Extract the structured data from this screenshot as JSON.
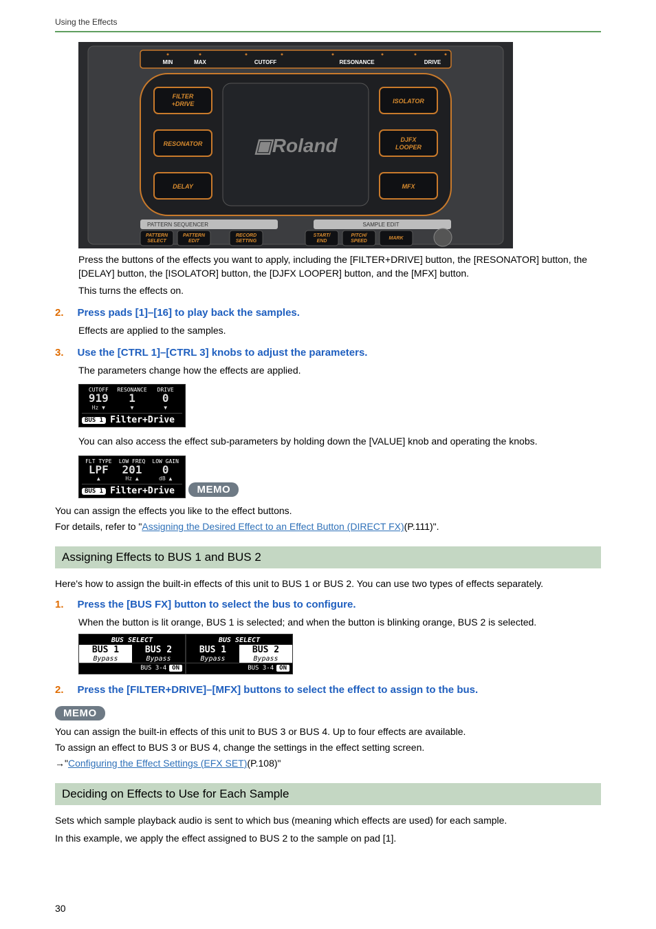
{
  "running_head": "Using the Effects",
  "page_number": "30",
  "hero": {
    "top_labels": [
      "MIN",
      "MAX",
      "CUTOFF",
      "RESONANCE",
      "DRIVE"
    ],
    "left_buttons": [
      "FILTER\n+DRIVE",
      "RESONATOR",
      "DELAY"
    ],
    "center_logo": "Roland",
    "right_buttons": [
      "ISOLATOR",
      "DJFX\nLOOPER",
      "MFX"
    ],
    "strip_left": "PATTERN SEQUENCER",
    "strip_right": "SAMPLE EDIT",
    "bottom_buttons": [
      "PATTERN\nSELECT",
      "PATTERN\nEDIT",
      "RECORD\nSETTING",
      "START/\nEND",
      "PITCH/\nSPEED",
      "MARK"
    ]
  },
  "para_after_hero_1": "Press the buttons of the effects you want to apply, including the [FILTER+DRIVE] button, the [RESONATOR] button, the [DELAY] button, the [ISOLATOR] button, the [DJFX LOOPER] button, and the [MFX] button.",
  "para_after_hero_2": "This turns the effects on.",
  "step2_num": "2.",
  "step2_text": "Press pads [1]–[16] to play back the samples.",
  "step2_after": "Effects are applied to the samples.",
  "step3_num": "3.",
  "step3_text": "Use the [CTRL 1]–[CTRL 3] knobs to adjust the parameters.",
  "step3_after": "The parameters change how the effects are applied.",
  "lcd1": {
    "headers": [
      "CUTOFF",
      "RESONANCE",
      "DRIVE"
    ],
    "values": [
      "919",
      "1",
      "0"
    ],
    "subs": [
      "Hz ▼",
      "▼",
      "▼"
    ],
    "bus": "BUS 1",
    "name": "Filter+Drive"
  },
  "step3_after2": "You can also access the effect sub-parameters by holding down the [VALUE] knob and operating the knobs.",
  "lcd2": {
    "headers": [
      "FLT TYPE",
      "LOW FREQ",
      "LOW GAIN"
    ],
    "values": [
      "LPF",
      "201",
      "0"
    ],
    "subs": [
      "▲",
      "Hz ▲",
      "dB ▲"
    ],
    "bus": "BUS 1",
    "name": "Filter+Drive"
  },
  "memo1": {
    "label": "MEMO",
    "line1": "You can assign the effects you like to the effect buttons.",
    "line2_pre": "For details, refer to \"",
    "line2_link": "Assigning the Desired Effect to an Effect Button (DIRECT FX)",
    "line2_post": "(P.111)\"."
  },
  "sectionA": "Assigning Effects to BUS 1 and BUS 2",
  "sectionA_lead": "Here's how to assign the built-in effects of this unit to BUS 1 or BUS 2. You can use two types of effects separately.",
  "sa_step1_num": "1.",
  "sa_step1_text": "Press the [BUS FX] button to select the bus to configure.",
  "sa_step1_after": "When the button is lit orange, BUS 1 is selected; and when the button is blinking orange, BUS 2 is selected.",
  "bus_select": {
    "title": "BUS SELECT",
    "col1": "BUS 1",
    "col2": "BUS 2",
    "bypass": "Bypass",
    "footer_label": "BUS 3-4",
    "footer_on": "ON"
  },
  "sa_step2_num": "2.",
  "sa_step2_text": "Press the [FILTER+DRIVE]–[MFX] buttons to select the effect to assign to the bus.",
  "memo2": {
    "label": "MEMO",
    "line1": "You can assign the built-in effects of this unit to BUS 3 or BUS 4. Up to four effects are available.",
    "line2": "To assign an effect to BUS 3 or BUS 4, change the settings in the effect setting screen.",
    "line3_arrow": "→\"",
    "line3_link": "Configuring the Effect Settings (EFX SET)",
    "line3_post": "(P.108)\""
  },
  "sectionB": "Deciding on Effects to Use for Each Sample",
  "sectionB_p1": "Sets which sample playback audio is sent to which bus (meaning which effects are used) for each sample.",
  "sectionB_p2": "In this example, we apply the effect assigned to BUS 2 to the sample on pad [1]."
}
